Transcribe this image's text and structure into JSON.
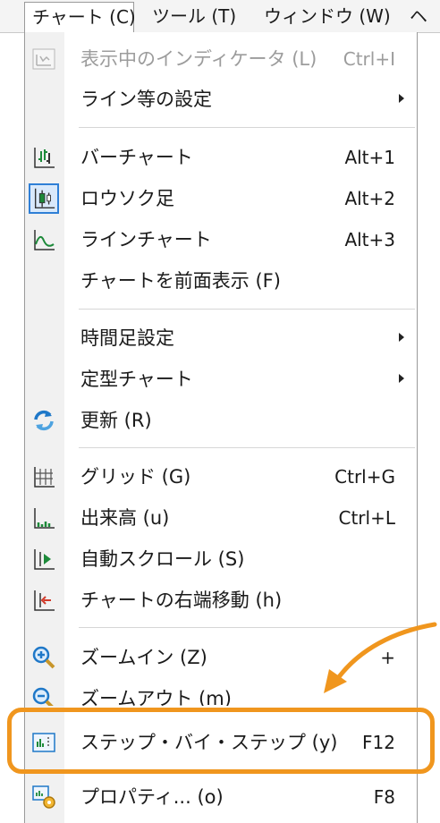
{
  "menubar": {
    "chart": "チャート (C)",
    "tools": "ツール (T)",
    "window": "ウィンドウ (W)",
    "more": "ヘ"
  },
  "menu": {
    "items": [
      {
        "label": "表示中のインディケータ (L)",
        "shortcut": "Ctrl+I",
        "icon": "indicators-icon",
        "disabled": true
      },
      {
        "label": "ライン等の設定",
        "submenu": true
      },
      {
        "label": "バーチャート",
        "shortcut": "Alt+1",
        "icon": "bar-chart-icon"
      },
      {
        "label": "ロウソク足",
        "shortcut": "Alt+2",
        "icon": "candlestick-icon",
        "selected": true
      },
      {
        "label": "ラインチャート",
        "shortcut": "Alt+3",
        "icon": "line-chart-icon"
      },
      {
        "label": "チャートを前面表示 (F)"
      },
      {
        "label": "時間足設定",
        "submenu": true
      },
      {
        "label": "定型チャート",
        "submenu": true
      },
      {
        "label": "更新 (R)",
        "icon": "refresh-icon"
      },
      {
        "label": "グリッド (G)",
        "shortcut": "Ctrl+G",
        "icon": "grid-icon"
      },
      {
        "label": "出来高 (u)",
        "shortcut": "Ctrl+L",
        "icon": "volume-icon"
      },
      {
        "label": "自動スクロール (S)",
        "icon": "auto-scroll-icon"
      },
      {
        "label": "チャートの右端移動 (h)",
        "icon": "chart-shift-icon"
      },
      {
        "label": "ズームイン (Z)",
        "shortcut": "+",
        "icon": "zoom-in-icon"
      },
      {
        "label": "ズームアウト (m)",
        "icon": "zoom-out-icon"
      },
      {
        "label": "ステップ・バイ・ステップ (y)",
        "shortcut": "F12",
        "icon": "step-by-step-icon"
      },
      {
        "label": "プロパティ... (o)",
        "shortcut": "F8",
        "icon": "properties-icon"
      }
    ]
  },
  "colors": {
    "highlight": "#f0961e",
    "selection_border": "#2f7fd6",
    "disabled_text": "#9c9c9c",
    "icon_strip": "#f1f1f1"
  }
}
